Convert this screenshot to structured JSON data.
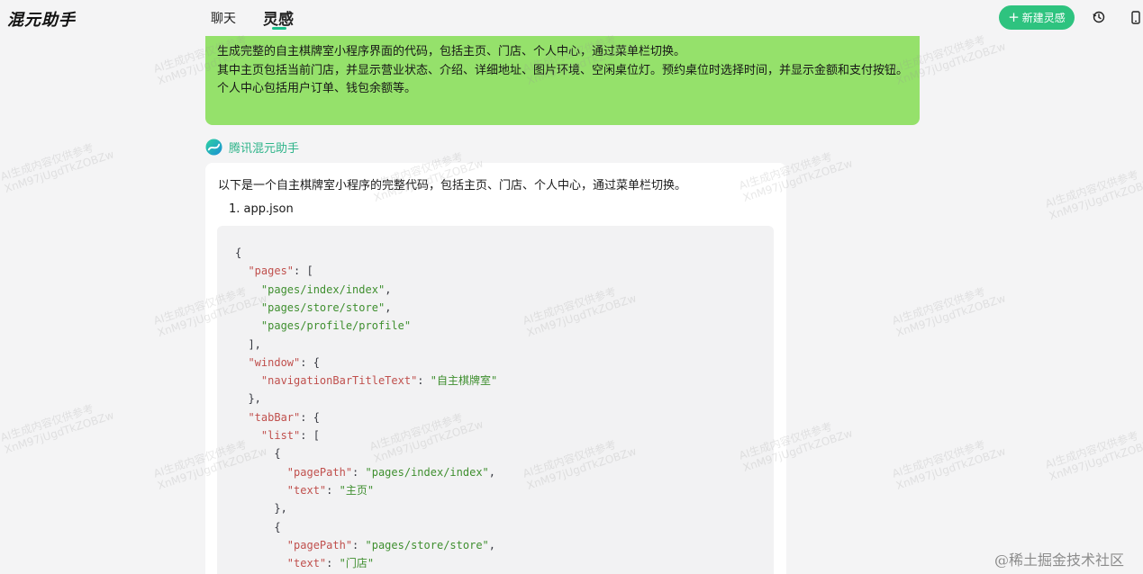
{
  "app": {
    "title": "混元助手"
  },
  "tabs": {
    "chat": "聊天",
    "inspiration": "灵感"
  },
  "header": {
    "new_button": "新建灵感",
    "history_icon": "history-icon",
    "phone_icon": "phone-icon"
  },
  "colors": {
    "accent": "#2ec37f",
    "user_bubble": "#95e16b",
    "code_key": "#c0504d",
    "code_string": "#3f8f2f"
  },
  "user_message": {
    "lines": [
      "生成完整的自主棋牌室小程序界面的代码，包括主页、门店、个人中心，通过菜单栏切换。",
      "其中主页包括当前门店，并显示营业状态、介绍、详细地址、图片环境、空闲桌位灯。预约桌位时选择时间，并显示金额和支付按钮。",
      "个人中心包括用户订单、钱包余额等。"
    ]
  },
  "assistant": {
    "name": "腾讯混元助手",
    "intro": "以下是一个自主棋牌室小程序的完整代码，包括主页、门店、个人中心，通过菜单栏切换。",
    "list_item": "1. app.json",
    "code": [
      {
        "indent": "",
        "parts": [
          [
            "p",
            "{"
          ]
        ]
      },
      {
        "indent": "  ",
        "parts": [
          [
            "k",
            "\"pages\""
          ],
          [
            "p",
            ": ["
          ]
        ]
      },
      {
        "indent": "    ",
        "parts": [
          [
            "s",
            "\"pages/index/index\""
          ],
          [
            "p",
            ","
          ]
        ]
      },
      {
        "indent": "    ",
        "parts": [
          [
            "s",
            "\"pages/store/store\""
          ],
          [
            "p",
            ","
          ]
        ]
      },
      {
        "indent": "    ",
        "parts": [
          [
            "s",
            "\"pages/profile/profile\""
          ]
        ]
      },
      {
        "indent": "  ",
        "parts": [
          [
            "p",
            "],"
          ]
        ]
      },
      {
        "indent": "  ",
        "parts": [
          [
            "k",
            "\"window\""
          ],
          [
            "p",
            ": {"
          ]
        ]
      },
      {
        "indent": "    ",
        "parts": [
          [
            "k",
            "\"navigationBarTitleText\""
          ],
          [
            "p",
            ": "
          ],
          [
            "s",
            "\"自主棋牌室\""
          ]
        ]
      },
      {
        "indent": "  ",
        "parts": [
          [
            "p",
            "},"
          ]
        ]
      },
      {
        "indent": "  ",
        "parts": [
          [
            "k",
            "\"tabBar\""
          ],
          [
            "p",
            ": {"
          ]
        ]
      },
      {
        "indent": "    ",
        "parts": [
          [
            "k",
            "\"list\""
          ],
          [
            "p",
            ": ["
          ]
        ]
      },
      {
        "indent": "      ",
        "parts": [
          [
            "p",
            "{"
          ]
        ]
      },
      {
        "indent": "        ",
        "parts": [
          [
            "k",
            "\"pagePath\""
          ],
          [
            "p",
            ": "
          ],
          [
            "s",
            "\"pages/index/index\""
          ],
          [
            "p",
            ","
          ]
        ]
      },
      {
        "indent": "        ",
        "parts": [
          [
            "k",
            "\"text\""
          ],
          [
            "p",
            ": "
          ],
          [
            "s",
            "\"主页\""
          ]
        ]
      },
      {
        "indent": "      ",
        "parts": [
          [
            "p",
            "},"
          ]
        ]
      },
      {
        "indent": "      ",
        "parts": [
          [
            "p",
            "{"
          ]
        ]
      },
      {
        "indent": "        ",
        "parts": [
          [
            "k",
            "\"pagePath\""
          ],
          [
            "p",
            ": "
          ],
          [
            "s",
            "\"pages/store/store\""
          ],
          [
            "p",
            ","
          ]
        ]
      },
      {
        "indent": "        ",
        "parts": [
          [
            "k",
            "\"text\""
          ],
          [
            "p",
            ": "
          ],
          [
            "s",
            "\"门店\""
          ]
        ]
      }
    ]
  },
  "watermark": {
    "line1": "AI生成内容仅供参考",
    "line2": "XnM97jUgdTkZOBZw"
  },
  "footer": {
    "site_mark": "@稀土掘金技术社区"
  }
}
